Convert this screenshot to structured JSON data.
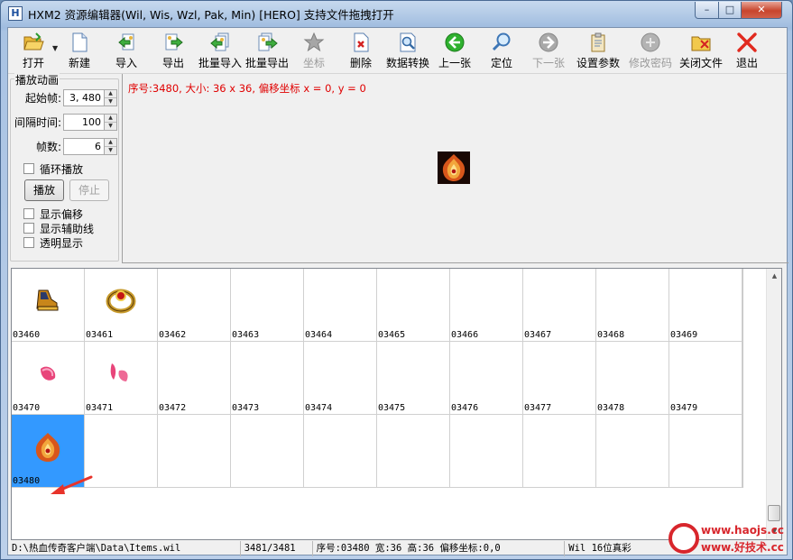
{
  "window": {
    "title": "HXM2 资源编辑器(Wil, Wis, Wzl, Pak, Min) [HERO] 支持文件拖拽打开",
    "app_icon_glyph": "H"
  },
  "toolbar": {
    "items": [
      {
        "id": "open",
        "label": "打开",
        "icon": "folder-open-icon",
        "enabled": true
      },
      {
        "id": "new",
        "label": "新建",
        "icon": "new-file-icon",
        "enabled": true
      },
      {
        "id": "import",
        "label": "导入",
        "icon": "import-icon",
        "enabled": true
      },
      {
        "id": "export",
        "label": "导出",
        "icon": "export-icon",
        "enabled": true
      },
      {
        "id": "batch-import",
        "label": "批量导入",
        "icon": "batch-import-icon",
        "enabled": true
      },
      {
        "id": "batch-export",
        "label": "批量导出",
        "icon": "batch-export-icon",
        "enabled": true
      },
      {
        "id": "coords",
        "label": "坐标",
        "icon": "star-icon",
        "enabled": false
      },
      {
        "id": "delete",
        "label": "删除",
        "icon": "delete-file-icon",
        "enabled": true
      },
      {
        "id": "convert",
        "label": "数据转换",
        "icon": "magnifier-document-icon",
        "enabled": true
      },
      {
        "id": "prev",
        "label": "上一张",
        "icon": "arrow-left-icon",
        "enabled": true
      },
      {
        "id": "locate",
        "label": "定位",
        "icon": "magnifier-icon",
        "enabled": true
      },
      {
        "id": "next",
        "label": "下一张",
        "icon": "arrow-right-icon",
        "enabled": false
      },
      {
        "id": "settings",
        "label": "设置参数",
        "icon": "clipboard-icon",
        "enabled": true
      },
      {
        "id": "change-password",
        "label": "修改密码",
        "icon": "lock-disc-icon",
        "enabled": false
      },
      {
        "id": "close-file",
        "label": "关闭文件",
        "icon": "close-folder-icon",
        "enabled": true
      },
      {
        "id": "exit",
        "label": "退出",
        "icon": "red-x-icon",
        "enabled": true
      }
    ]
  },
  "anim_panel": {
    "legend": "播放动画",
    "start_frame_label": "起始帧:",
    "start_frame_value": "3, 480",
    "interval_label": "间隔时间:",
    "interval_value": "100",
    "frames_label": "帧数:",
    "frames_value": "6",
    "loop_label": "循环播放",
    "play_label": "播放",
    "stop_label": "停止",
    "show_offset_label": "显示偏移",
    "show_guides_label": "显示辅助线",
    "transparent_label": "透明显示"
  },
  "preview": {
    "info": "序号:3480, 大小: 36 x 36, 偏移坐标 x = 0, y = 0"
  },
  "grid": {
    "cells": [
      {
        "label": "03460",
        "sprite": "boots"
      },
      {
        "label": "03461",
        "sprite": "ring"
      },
      {
        "label": "03462",
        "sprite": ""
      },
      {
        "label": "03463",
        "sprite": ""
      },
      {
        "label": "03464",
        "sprite": ""
      },
      {
        "label": "03465",
        "sprite": ""
      },
      {
        "label": "03466",
        "sprite": ""
      },
      {
        "label": "03467",
        "sprite": ""
      },
      {
        "label": "03468",
        "sprite": ""
      },
      {
        "label": "03469",
        "sprite": ""
      },
      {
        "label": "03470",
        "sprite": "petal"
      },
      {
        "label": "03471",
        "sprite": "petals"
      },
      {
        "label": "03472",
        "sprite": ""
      },
      {
        "label": "03473",
        "sprite": ""
      },
      {
        "label": "03474",
        "sprite": ""
      },
      {
        "label": "03475",
        "sprite": ""
      },
      {
        "label": "03476",
        "sprite": ""
      },
      {
        "label": "03477",
        "sprite": ""
      },
      {
        "label": "03478",
        "sprite": ""
      },
      {
        "label": "03479",
        "sprite": ""
      },
      {
        "label": "03480",
        "sprite": "flame-helmet",
        "selected": true
      }
    ],
    "selected_label": "03480"
  },
  "statusbar": {
    "path": "D:\\热血传奇客户端\\Data\\Items.wil",
    "position": "3481/3481",
    "detail": "序号:03480 宽:36 高:36 偏移坐标:0,0",
    "format": "Wil 16位真彩"
  },
  "watermark": {
    "line1": "www.haojs.cc",
    "line2": "www.好技术.cc"
  },
  "colors": {
    "info_text": "#e00000",
    "selection": "#3399ff",
    "annotation_arrow": "#e8332a"
  }
}
